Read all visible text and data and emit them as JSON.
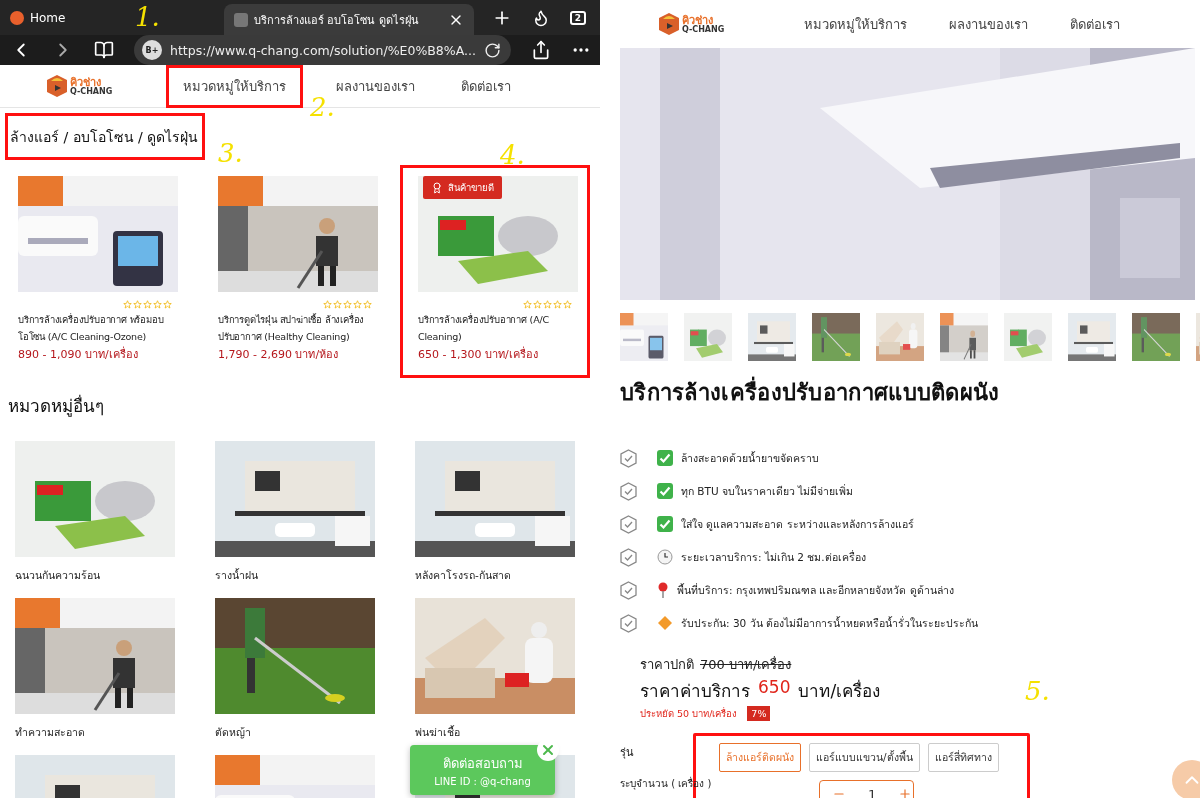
{
  "left": {
    "browser": {
      "tabs": [
        {
          "title": "Home",
          "selected": false
        },
        {
          "title": "บริการล้างแอร์ อบโอโซน ดูดไรฝุ่น",
          "selected": true
        }
      ],
      "tab_count": "2",
      "site_badge": "B+",
      "url": "https://www.q-chang.com/solution/%E0%B8%A..."
    },
    "logo": {
      "thai": "คิวช่าง",
      "latin": "Q-CHANG"
    },
    "nav": [
      {
        "label": "หมวดหมู่ให้บริการ",
        "highlighted": true
      },
      {
        "label": "ผลงานของเรา",
        "highlighted": false
      },
      {
        "label": "ติดต่อเรา",
        "highlighted": false
      }
    ],
    "heading": {
      "text": "ล้างแอร์ / อบโอโซน / ดูดไรฝุ่น",
      "highlighted": true
    },
    "products": [
      {
        "title": "บริการล้างเครื่องปรับอากาศ พร้อมอบโอโซน (A/C Cleaning-Ozone)",
        "price": "890 - 1,090 บาท/เครื่อง",
        "stars": 0,
        "highlighted": false
      },
      {
        "title": "บริการดูดไรฝุ่น สปาฆ่าเชื้อ ล้างเครื่องปรับอากาศ (Healthy Cleaning)",
        "price": "1,790 - 2,690 บาท/ห้อง",
        "stars": 0,
        "highlighted": false
      },
      {
        "title": "บริการล้างเครื่องปรับอากาศ (A/C Cleaning)",
        "price": "650 - 1,300 บาท/เครื่อง",
        "stars": 0,
        "highlighted": true,
        "badge": "สินค้าขายดี"
      }
    ],
    "other_heading": "หมวดหมู่อื่นๆ",
    "categories": [
      {
        "label": "ฉนวนกันความร้อน"
      },
      {
        "label": "รางน้ำฝน"
      },
      {
        "label": "หลังคาโรงรถ-กันสาด"
      },
      {
        "label": "ทำความสะอาด"
      },
      {
        "label": "ตัดหญ้า"
      },
      {
        "label": "พ่นฆ่าเชื้อ"
      },
      {
        "kind": "picture"
      },
      {
        "kind": "picture"
      },
      {
        "kind": "picture"
      }
    ],
    "chat": {
      "title": "ติดต่อสอบถาม",
      "line_id": "LINE ID : @q-chang"
    }
  },
  "right": {
    "logo": {
      "thai": "คิวช่าง",
      "latin": "Q-CHANG"
    },
    "nav": [
      {
        "label": "หมวดหมู่ให้บริการ"
      },
      {
        "label": "ผลงานของเรา"
      },
      {
        "label": "ติดต่อเรา"
      }
    ],
    "thumbnails": [
      {
        "kind": "picture"
      },
      {
        "kind": "picture"
      },
      {
        "kind": "picture"
      },
      {
        "kind": "picture"
      },
      {
        "kind": "picture"
      },
      {
        "kind": "picture"
      },
      {
        "kind": "picture"
      },
      {
        "kind": "picture"
      },
      {
        "kind": "picture"
      },
      {
        "kind": "picture"
      }
    ],
    "title": "บริการล้างเครื่องปรับอากาศแบบติดผนัง",
    "features": [
      {
        "kind": "check",
        "text": "ล้างสะอาดด้วยน้ำยาขจัดคราบ"
      },
      {
        "kind": "check",
        "text": "ทุก BTU จบในราคาเดียว ไม่มีจ่ายเพิ่ม"
      },
      {
        "kind": "check",
        "text": "ใส่ใจ ดูแลความสะอาด ระหว่างและหลังการล้างแอร์"
      },
      {
        "kind": "clock",
        "text": "ระยะเวลาบริการ: ไม่เกิน 2 ชม.ต่อเครื่อง"
      },
      {
        "kind": "pin",
        "text": "พื้นที่บริการ: กรุงเทพปริมณฑล และอีกหลายจังหวัด ดูด้านล่าง"
      },
      {
        "kind": "diamond",
        "text": "รับประกัน: 30 วัน ต้องไม่มีอาการน้ำหยดหรือน้ำรั่วในระยะประกัน"
      }
    ],
    "regular_label": "ราคาปกติ",
    "regular_price": "700 บาท/เครื่อง",
    "service_label": "ราคาค่าบริการ",
    "service_price": "650",
    "service_unit": "บาท/เครื่อง",
    "savings": "ประหยัด 50 บาท/เครื่อง",
    "discount": "7%",
    "variant_label": "รุ่น",
    "variants_highlighted": true,
    "variants": [
      {
        "label": "ล้างแอร์ติดผนัง",
        "selected": true
      },
      {
        "label": "แอร์แบบแขวน/ตั้งพื้น",
        "selected": false
      },
      {
        "label": "แอร์สี่ทิศทาง",
        "selected": false
      }
    ],
    "quantity_label": "ระบุจำนวน ( เครื่อง )",
    "quantity": "1"
  },
  "annotations": [
    {
      "label": "1."
    },
    {
      "label": "2."
    },
    {
      "label": "3."
    },
    {
      "label": "4."
    },
    {
      "label": "5."
    }
  ]
}
